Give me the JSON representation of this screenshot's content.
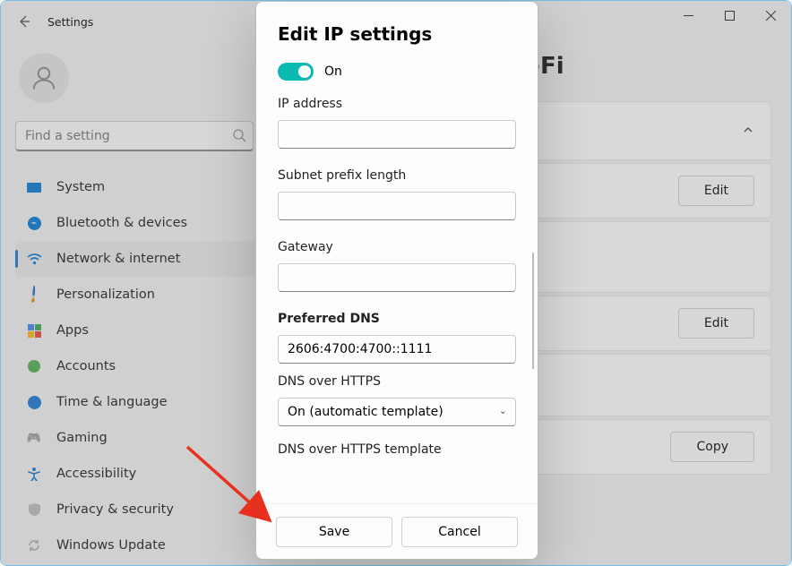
{
  "titlebar": {
    "title": "Settings"
  },
  "search": {
    "placeholder": "Find a setting"
  },
  "nav": [
    {
      "label": "System"
    },
    {
      "label": "Bluetooth & devices"
    },
    {
      "label": "Network & internet"
    },
    {
      "label": "Personalization"
    },
    {
      "label": "Apps"
    },
    {
      "label": "Accounts"
    },
    {
      "label": "Time & language"
    },
    {
      "label": "Gaming"
    },
    {
      "label": "Accessibility"
    },
    {
      "label": "Privacy & security"
    },
    {
      "label": "Windows Update"
    }
  ],
  "breadcrumb": {
    "level1": "Wi-Fi",
    "current": "Wi-Fi"
  },
  "cards": {
    "edit1": "Edit",
    "edit2": "Edit",
    "copy": "Copy"
  },
  "dialog": {
    "title": "Edit IP settings",
    "toggle_state": "On",
    "ip_label": "IP address",
    "ip_value": "",
    "subnet_label": "Subnet prefix length",
    "subnet_value": "",
    "gateway_label": "Gateway",
    "gateway_value": "",
    "dns_label": "Preferred DNS",
    "dns_value": "2606:4700:4700::1111",
    "doh_label": "DNS over HTTPS",
    "doh_value": "On (automatic template)",
    "doh_template_label": "DNS over HTTPS template",
    "save": "Save",
    "cancel": "Cancel"
  }
}
